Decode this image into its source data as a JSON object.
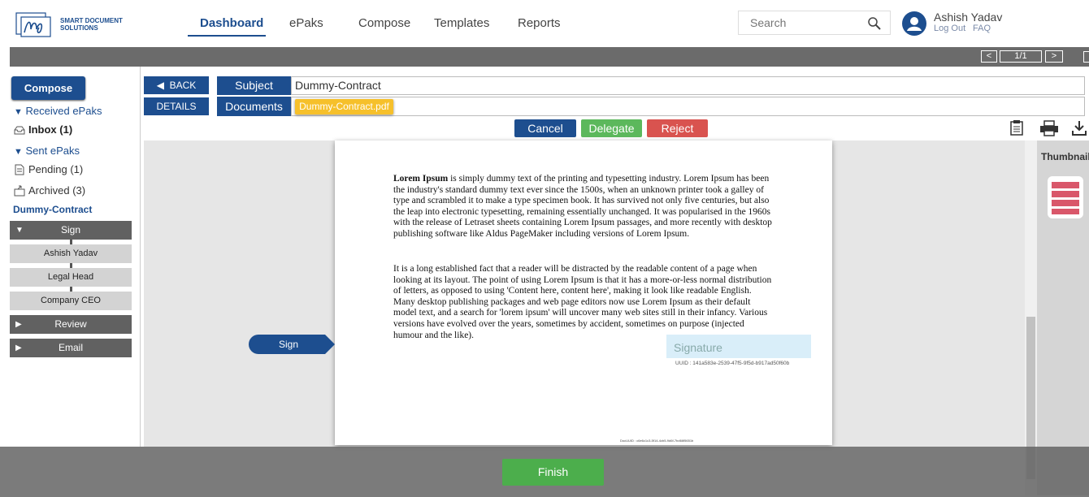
{
  "brand": {
    "line1": "SMART DOCUMENT",
    "line2": "SOLUTIONS"
  },
  "nav": {
    "dashboard": "Dashboard",
    "epaks": "ePaks",
    "compose": "Compose",
    "templates": "Templates",
    "reports": "Reports"
  },
  "search": {
    "placeholder": "Search"
  },
  "user": {
    "name": "Ashish Yadav",
    "logout": "Log Out",
    "faq": "FAQ"
  },
  "pager": {
    "prev": "<",
    "page": "1/1",
    "next": ">"
  },
  "sidebar": {
    "compose": "Compose",
    "received_head": "Received ePaks",
    "inbox": "Inbox (1)",
    "sent_head": "Sent ePaks",
    "pending": "Pending (1)",
    "archived": "Archived (3)",
    "doc_name": "Dummy-Contract",
    "workflow": {
      "sign": "Sign",
      "signers": [
        "Ashish Yadav",
        "Legal Head",
        "Company CEO"
      ],
      "review": "Review",
      "email": "Email"
    }
  },
  "form": {
    "back": "BACK",
    "details": "DETAILS",
    "subject_label": "Subject",
    "subject_value": "Dummy-Contract",
    "documents_label": "Documents",
    "document_file": "Dummy-Contract.pdf"
  },
  "actions": {
    "cancel": "Cancel",
    "delegate": "Delegate",
    "reject": "Reject"
  },
  "document": {
    "p1_bold": "Lorem Ipsum",
    "p1": " is simply dummy text of the printing and typesetting industry. Lorem Ipsum has been the industry's standard dummy text ever since the 1500s, when an unknown printer took a galley of type and scrambled it to make a type specimen book. It has survived not only five centuries, but also the leap into electronic typesetting, remaining essentially unchanged. It was popularised in the 1960s with the release of Letraset sheets containing Lorem Ipsum passages, and more recently with desktop publishing software like Aldus PageMaker including versions of Lorem Ipsum.",
    "p2": "It is a long established fact that a reader will be distracted by the readable content of a page when looking at its layout. The point of using Lorem Ipsum is that it has a more-or-less normal distribution of letters, as opposed to using 'Content here, content here', making it look like readable English. Many desktop publishing packages and web page editors now use Lorem Ipsum as their default model text, and a search for 'lorem ipsum' will uncover many web sites still in their infancy. Various versions have evolved over the years, sometimes by accident, sometimes on purpose (injected humour and the like).",
    "signature_placeholder": "Signature",
    "uuid": "UUID : 141a583e-2539-47f5-9f5d-b917ad50f60b",
    "doc_uuid": "DocUUID : c6e6c1c3-5f14-4cb5-9d6f-7bd66f5651b"
  },
  "sign_tag": "Sign",
  "thumbnails_title": "Thumbnails",
  "finish": "Finish",
  "colors": {
    "primary": "#1d4e8f",
    "delegate": "#5cb85c",
    "reject": "#d9534f",
    "chip": "#f6c02b"
  }
}
